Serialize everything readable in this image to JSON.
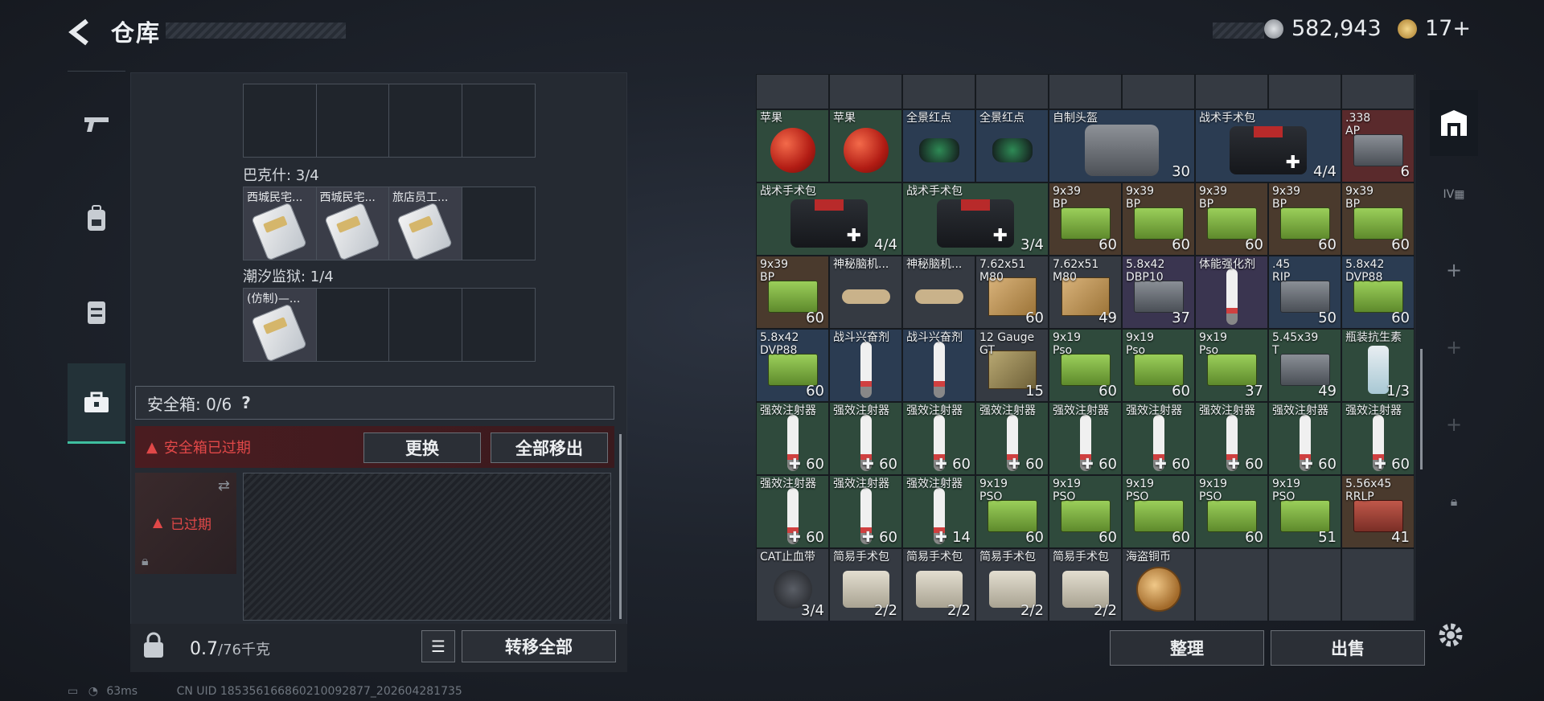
{
  "header": {
    "title": "仓库",
    "currency1": "582,943",
    "currency2": "17+"
  },
  "nav": [
    "weapon-icon",
    "backpack-icon",
    "vest-icon",
    "case-icon"
  ],
  "left": {
    "top_group_label": "",
    "groups": [
      {
        "label": "巴克什: 3/4",
        "items": [
          "西城民宅...",
          "西城民宅...",
          "旅店员工...",
          ""
        ]
      },
      {
        "label": "潮汐监狱: 1/4",
        "items": [
          "(仿制)—...",
          "",
          "",
          ""
        ]
      }
    ],
    "safe_box": {
      "label": "安全箱: 0/6",
      "help": "?",
      "warning": "安全箱已过期",
      "replace": "更换",
      "move_all": "全部移出",
      "expired": "已过期"
    },
    "weight": {
      "value": "0.7",
      "max": "/76千克"
    },
    "transfer_all": "转移全部"
  },
  "grid": {
    "rows": [
      [
        {
          "n": "苹果",
          "c": "",
          "bg": "c-green",
          "ic": "apple"
        },
        {
          "n": "苹果",
          "c": "",
          "bg": "c-green",
          "ic": "apple"
        },
        {
          "n": "全景红点",
          "c": "",
          "bg": "c-blue",
          "ic": "scope"
        },
        {
          "n": "全景红点",
          "c": "",
          "bg": "c-blue",
          "ic": "scope"
        },
        {
          "n": "自制头盔",
          "c": "30",
          "bg": "c-blue",
          "ic": "helmet",
          "w": 2
        },
        {
          "n": "战术手术包",
          "c": "4/4",
          "bg": "c-blue",
          "ic": "kit",
          "w": 2
        },
        {
          "n": ".338\nAP",
          "c": "6",
          "bg": "c-red",
          "ic": "ammo gray"
        }
      ],
      [
        {
          "n": "战术手术包",
          "c": "4/4",
          "bg": "c-green",
          "ic": "kit",
          "w": 2
        },
        {
          "n": "战术手术包",
          "c": "3/4",
          "bg": "c-green",
          "ic": "kit",
          "w": 2
        },
        {
          "n": "9x39\nBP",
          "c": "60",
          "bg": "c-brown",
          "ic": "ammo"
        },
        {
          "n": "9x39\nBP",
          "c": "60",
          "bg": "c-brown",
          "ic": "ammo"
        },
        {
          "n": "9x39\nBP",
          "c": "60",
          "bg": "c-brown",
          "ic": "ammo"
        },
        {
          "n": "9x39\nBP",
          "c": "60",
          "bg": "c-brown",
          "ic": "ammo"
        },
        {
          "n": "9x39\nBP",
          "c": "60",
          "bg": "c-brown",
          "ic": "ammo"
        }
      ],
      [
        {
          "n": "9x39\nBP",
          "c": "60",
          "bg": "c-brown",
          "ic": "ammo"
        },
        {
          "n": "神秘脑机...",
          "c": "",
          "bg": "c-gray",
          "ic": "strap"
        },
        {
          "n": "神秘脑机...",
          "c": "",
          "bg": "c-gray",
          "ic": "strap"
        },
        {
          "n": "7.62x51\nM80",
          "c": "60",
          "bg": "c-gray",
          "ic": "box"
        },
        {
          "n": "7.62x51\nM80",
          "c": "49",
          "bg": "c-gray",
          "ic": "box"
        },
        {
          "n": "5.8x42\nDBP10",
          "c": "37",
          "bg": "c-purple",
          "ic": "ammo gray"
        },
        {
          "n": "体能强化剂",
          "c": "",
          "bg": "c-purple",
          "ic": "inj"
        },
        {
          "n": ".45\nRIP",
          "c": "50",
          "bg": "c-blue",
          "ic": "ammo gray"
        },
        {
          "n": "5.8x42\nDVP88",
          "c": "60",
          "bg": "c-blue",
          "ic": "ammo"
        }
      ],
      [
        {
          "n": "5.8x42\nDVP88",
          "c": "60",
          "bg": "c-blue",
          "ic": "ammo"
        },
        {
          "n": "战斗兴奋剂",
          "c": "",
          "bg": "c-blue",
          "ic": "inj"
        },
        {
          "n": "战斗兴奋剂",
          "c": "",
          "bg": "c-blue",
          "ic": "inj"
        },
        {
          "n": "12 Gauge\nGT",
          "c": "15",
          "bg": "c-gray",
          "ic": "box olive"
        },
        {
          "n": "9x19\nPso",
          "c": "60",
          "bg": "c-green",
          "ic": "ammo"
        },
        {
          "n": "9x19\nPso",
          "c": "60",
          "bg": "c-green",
          "ic": "ammo"
        },
        {
          "n": "9x19\nPso",
          "c": "37",
          "bg": "c-green",
          "ic": "ammo"
        },
        {
          "n": "5.45x39\nT",
          "c": "49",
          "bg": "c-green",
          "ic": "ammo gray"
        },
        {
          "n": "瓶装抗生素",
          "c": "1/3",
          "bg": "c-green",
          "ic": "vial"
        }
      ],
      [
        {
          "n": "强效注射器",
          "c": "60",
          "bg": "c-green",
          "ic": "inj",
          "p": true
        },
        {
          "n": "强效注射器",
          "c": "60",
          "bg": "c-green",
          "ic": "inj",
          "p": true
        },
        {
          "n": "强效注射器",
          "c": "60",
          "bg": "c-green",
          "ic": "inj",
          "p": true
        },
        {
          "n": "强效注射器",
          "c": "60",
          "bg": "c-green",
          "ic": "inj",
          "p": true
        },
        {
          "n": "强效注射器",
          "c": "60",
          "bg": "c-green",
          "ic": "inj",
          "p": true
        },
        {
          "n": "强效注射器",
          "c": "60",
          "bg": "c-green",
          "ic": "inj",
          "p": true
        },
        {
          "n": "强效注射器",
          "c": "60",
          "bg": "c-green",
          "ic": "inj",
          "p": true
        },
        {
          "n": "强效注射器",
          "c": "60",
          "bg": "c-green",
          "ic": "inj",
          "p": true
        },
        {
          "n": "强效注射器",
          "c": "60",
          "bg": "c-green",
          "ic": "inj",
          "p": true
        }
      ],
      [
        {
          "n": "强效注射器",
          "c": "60",
          "bg": "c-green",
          "ic": "inj",
          "p": true
        },
        {
          "n": "强效注射器",
          "c": "60",
          "bg": "c-green",
          "ic": "inj",
          "p": true
        },
        {
          "n": "强效注射器",
          "c": "14",
          "bg": "c-green",
          "ic": "inj",
          "p": true
        },
        {
          "n": "9x19\nPSO",
          "c": "60",
          "bg": "c-green",
          "ic": "ammo"
        },
        {
          "n": "9x19\nPSO",
          "c": "60",
          "bg": "c-green",
          "ic": "ammo"
        },
        {
          "n": "9x19\nPSO",
          "c": "60",
          "bg": "c-green",
          "ic": "ammo"
        },
        {
          "n": "9x19\nPSO",
          "c": "60",
          "bg": "c-green",
          "ic": "ammo"
        },
        {
          "n": "9x19\nPSO",
          "c": "51",
          "bg": "c-green",
          "ic": "ammo"
        },
        {
          "n": "5.56x45\nRRLP",
          "c": "41",
          "bg": "c-brown",
          "ic": "ammo red"
        }
      ],
      [
        {
          "n": "CAT止血带",
          "c": "3/4",
          "bg": "c-gray",
          "ic": "tourn"
        },
        {
          "n": "简易手术包",
          "c": "2/2",
          "bg": "c-gray",
          "ic": "pouch"
        },
        {
          "n": "简易手术包",
          "c": "2/2",
          "bg": "c-gray",
          "ic": "pouch"
        },
        {
          "n": "简易手术包",
          "c": "2/2",
          "bg": "c-gray",
          "ic": "pouch"
        },
        {
          "n": "简易手术包",
          "c": "2/2",
          "bg": "c-gray",
          "ic": "pouch"
        },
        {
          "n": "海盗铜币",
          "c": "",
          "bg": "c-gray",
          "ic": "coinic"
        },
        {
          "n": "",
          "c": "",
          "bg": "c-gray",
          "ic": ""
        },
        {
          "n": "",
          "c": "",
          "bg": "c-gray",
          "ic": ""
        },
        {
          "n": "",
          "c": "",
          "bg": "c-gray",
          "ic": ""
        }
      ]
    ]
  },
  "right": {
    "organize": "整理",
    "sell": "出售"
  },
  "status": {
    "ping": "63ms",
    "uid": "CN UID 1853561668602100928​77_202604281735"
  }
}
